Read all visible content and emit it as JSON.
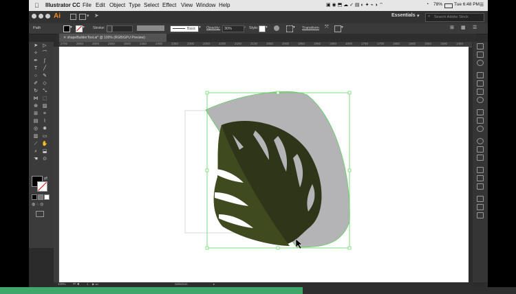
{
  "menubar": {
    "app_name": "Illustrator CC",
    "items": [
      "File",
      "Edit",
      "Object",
      "Type",
      "Select",
      "Effect",
      "View",
      "Window",
      "Help"
    ],
    "battery": "78%",
    "clock": "Tue 6:48 PM"
  },
  "appbar": {
    "logo": "Ai",
    "workspace": "Essentials",
    "search_placeholder": "Search Adobe Stock"
  },
  "control_bar": {
    "selection_label": "Path",
    "stroke_label": "Stroke:",
    "brush_label": "Basic",
    "opacity_label": "Opacity:",
    "opacity_value": "30%",
    "style_label": "Style:",
    "transform_label": "Transform"
  },
  "document": {
    "tab_title": "shapeBuilderTool.ai* @ 100% (RGB/GPU Preview)"
  },
  "ruler": {
    "h_ticks": [
      "2700",
      "2650",
      "2600",
      "2550",
      "2500",
      "2450",
      "2400",
      "2350",
      "2300",
      "2250",
      "2200",
      "2150",
      "2100",
      "2050",
      "2000",
      "1950",
      "1900",
      "1850",
      "1800",
      "1750",
      "1700",
      "1650",
      "1600",
      "1550",
      "1500",
      "1450"
    ],
    "v_ticks": []
  },
  "status_bar": {
    "zoom": "100%",
    "artboard": "1",
    "tool_name": "Selection"
  },
  "colors": {
    "leaf_dark": "#2e3519",
    "leaf_overlay": "#3f4a1e",
    "grey_shape": "#b4b4b6",
    "selection_green": "#5fd35f",
    "progress": "#3fa869"
  }
}
